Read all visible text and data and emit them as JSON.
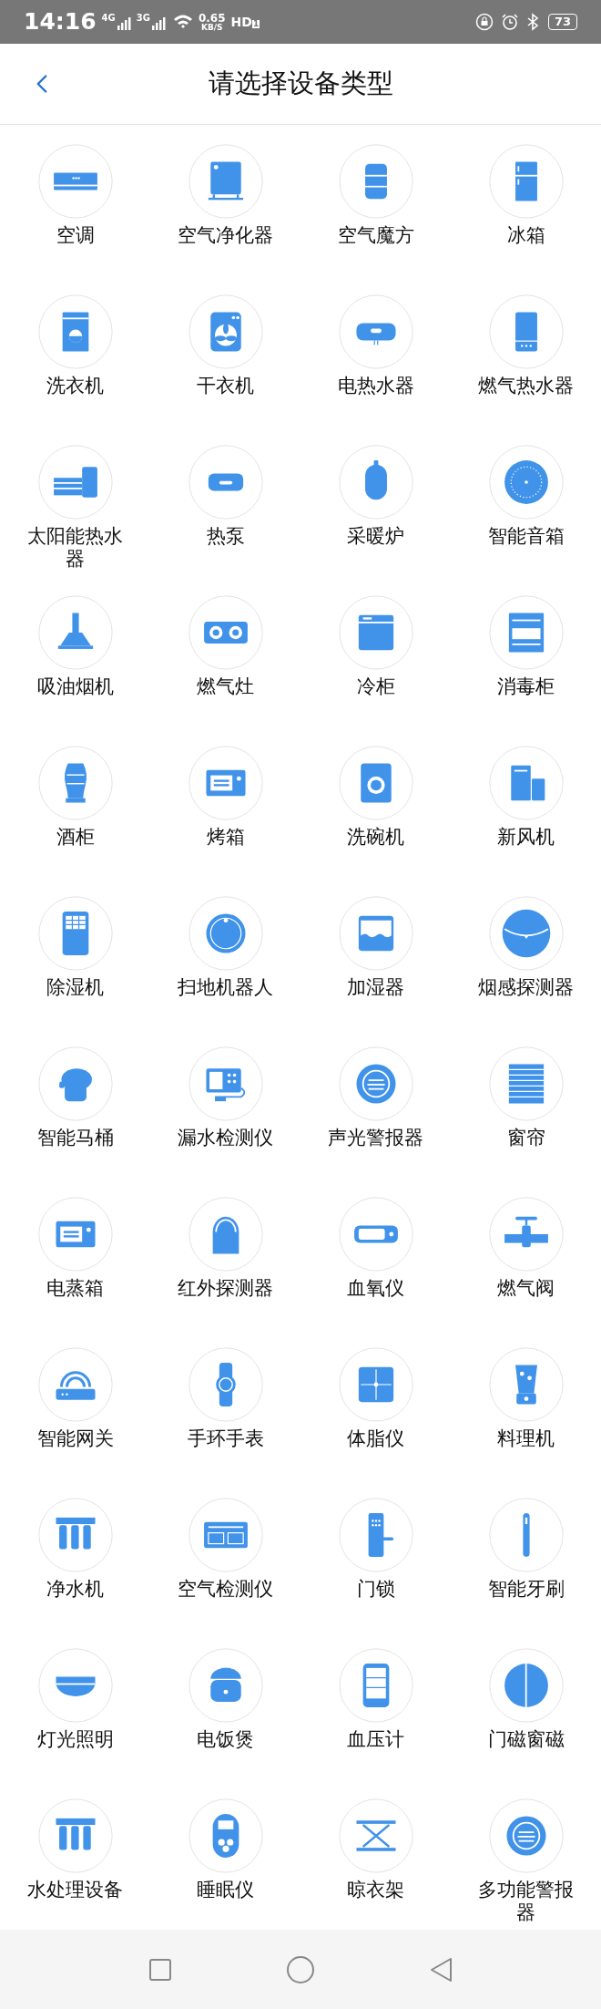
{
  "status_bar": {
    "time": "14:16",
    "network_1": "4G",
    "network_2": "3G",
    "speed": "0.65",
    "speed_unit": "KB/S",
    "hd": "HD",
    "hd_sub": "1",
    "battery": "73"
  },
  "header": {
    "title": "请选择设备类型"
  },
  "devices": [
    {
      "label": "空调"
    },
    {
      "label": "空气净化器"
    },
    {
      "label": "空气魔方"
    },
    {
      "label": "冰箱"
    },
    {
      "label": "洗衣机"
    },
    {
      "label": "干衣机"
    },
    {
      "label": "电热水器"
    },
    {
      "label": "燃气热水器"
    },
    {
      "label": "太阳能热水器"
    },
    {
      "label": "热泵"
    },
    {
      "label": "采暖炉"
    },
    {
      "label": "智能音箱"
    },
    {
      "label": "吸油烟机"
    },
    {
      "label": "燃气灶"
    },
    {
      "label": "冷柜"
    },
    {
      "label": "消毒柜"
    },
    {
      "label": "酒柜"
    },
    {
      "label": "烤箱"
    },
    {
      "label": "洗碗机"
    },
    {
      "label": "新风机"
    },
    {
      "label": "除湿机"
    },
    {
      "label": "扫地机器人"
    },
    {
      "label": "加湿器"
    },
    {
      "label": "烟感探测器"
    },
    {
      "label": "智能马桶"
    },
    {
      "label": "漏水检测仪"
    },
    {
      "label": "声光警报器"
    },
    {
      "label": "窗帘"
    },
    {
      "label": "电蒸箱"
    },
    {
      "label": "红外探测器"
    },
    {
      "label": "血氧仪"
    },
    {
      "label": "燃气阀"
    },
    {
      "label": "智能网关"
    },
    {
      "label": "手环手表"
    },
    {
      "label": "体脂仪"
    },
    {
      "label": "料理机"
    },
    {
      "label": "净水机"
    },
    {
      "label": "空气检测仪"
    },
    {
      "label": "门锁"
    },
    {
      "label": "智能牙刷"
    },
    {
      "label": "灯光照明"
    },
    {
      "label": "电饭煲"
    },
    {
      "label": "血压计"
    },
    {
      "label": "门磁窗磁"
    },
    {
      "label": "水处理设备"
    },
    {
      "label": "睡眠仪"
    },
    {
      "label": "晾衣架"
    },
    {
      "label": "多功能警报器"
    }
  ]
}
